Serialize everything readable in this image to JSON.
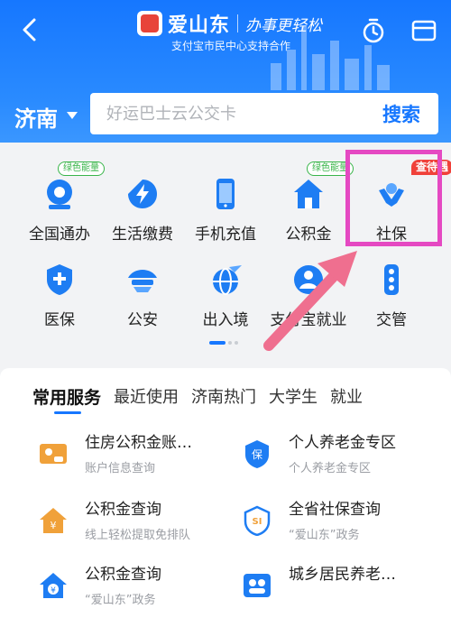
{
  "header": {
    "brand_name": "爱山东",
    "slogan": "办事更轻松",
    "subtitle": "支付宝市民中心支持合作",
    "city": "济南",
    "search_placeholder": "好运巴士云公交卡",
    "search_button": "搜索"
  },
  "grid": {
    "row1": [
      {
        "label": "全国通办",
        "tag": "绿色能量"
      },
      {
        "label": "生活缴费"
      },
      {
        "label": "手机充值"
      },
      {
        "label": "公积金",
        "tag": "绿色能量"
      },
      {
        "label": "社保",
        "badge": "查待遇"
      }
    ],
    "row2": [
      {
        "label": "医保"
      },
      {
        "label": "公安"
      },
      {
        "label": "出入境"
      },
      {
        "label": "支付宝就业"
      },
      {
        "label": "交管"
      }
    ]
  },
  "services": {
    "tabs": [
      "常用服务",
      "最近使用",
      "济南热门",
      "大学生",
      "就业"
    ],
    "active_tab": "常用服务",
    "items": [
      {
        "title": "住房公积金账…",
        "desc": "账户信息查询"
      },
      {
        "title": "个人养老金专区",
        "desc": "个人养老金专区"
      },
      {
        "title": "公积金查询",
        "desc": "线上轻松提取免排队"
      },
      {
        "title": "全省社保查询",
        "desc": "“爱山东”政务"
      },
      {
        "title": "公积金查询",
        "desc": "“爱山东”政务"
      },
      {
        "title": "城乡居民养老…",
        "desc": ""
      }
    ]
  },
  "colors": {
    "primary": "#1677ff",
    "highlight": "#e549c2",
    "arrow": "#ef6f8f",
    "green_tag": "#39b54a",
    "red_badge": "#f0413a"
  }
}
